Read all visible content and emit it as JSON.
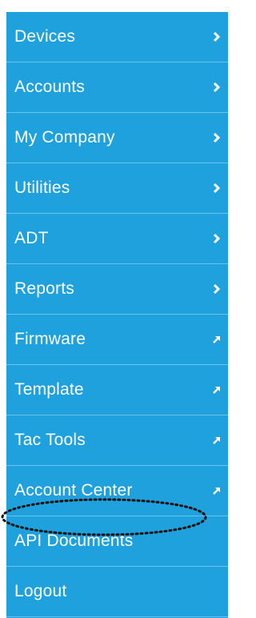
{
  "menu": {
    "items": [
      {
        "label": "Devices",
        "icon": "chevron-right-icon"
      },
      {
        "label": "Accounts",
        "icon": "chevron-right-icon"
      },
      {
        "label": "My Company",
        "icon": "chevron-right-icon"
      },
      {
        "label": "Utilities",
        "icon": "chevron-right-icon"
      },
      {
        "label": "ADT",
        "icon": "chevron-right-icon"
      },
      {
        "label": "Reports",
        "icon": "chevron-right-icon"
      },
      {
        "label": "Firmware",
        "icon": "external-link-arrow-icon"
      },
      {
        "label": "Template",
        "icon": "external-link-arrow-icon"
      },
      {
        "label": "Tac Tools",
        "icon": "external-link-arrow-icon"
      },
      {
        "label": "Account Center",
        "icon": "external-link-arrow-icon"
      },
      {
        "label": "API Documents",
        "icon": ""
      },
      {
        "label": "Logout",
        "icon": ""
      }
    ],
    "background_color": "#1ea1dd",
    "text_color": "#ffffff",
    "highlighted_item": "API Documents"
  }
}
